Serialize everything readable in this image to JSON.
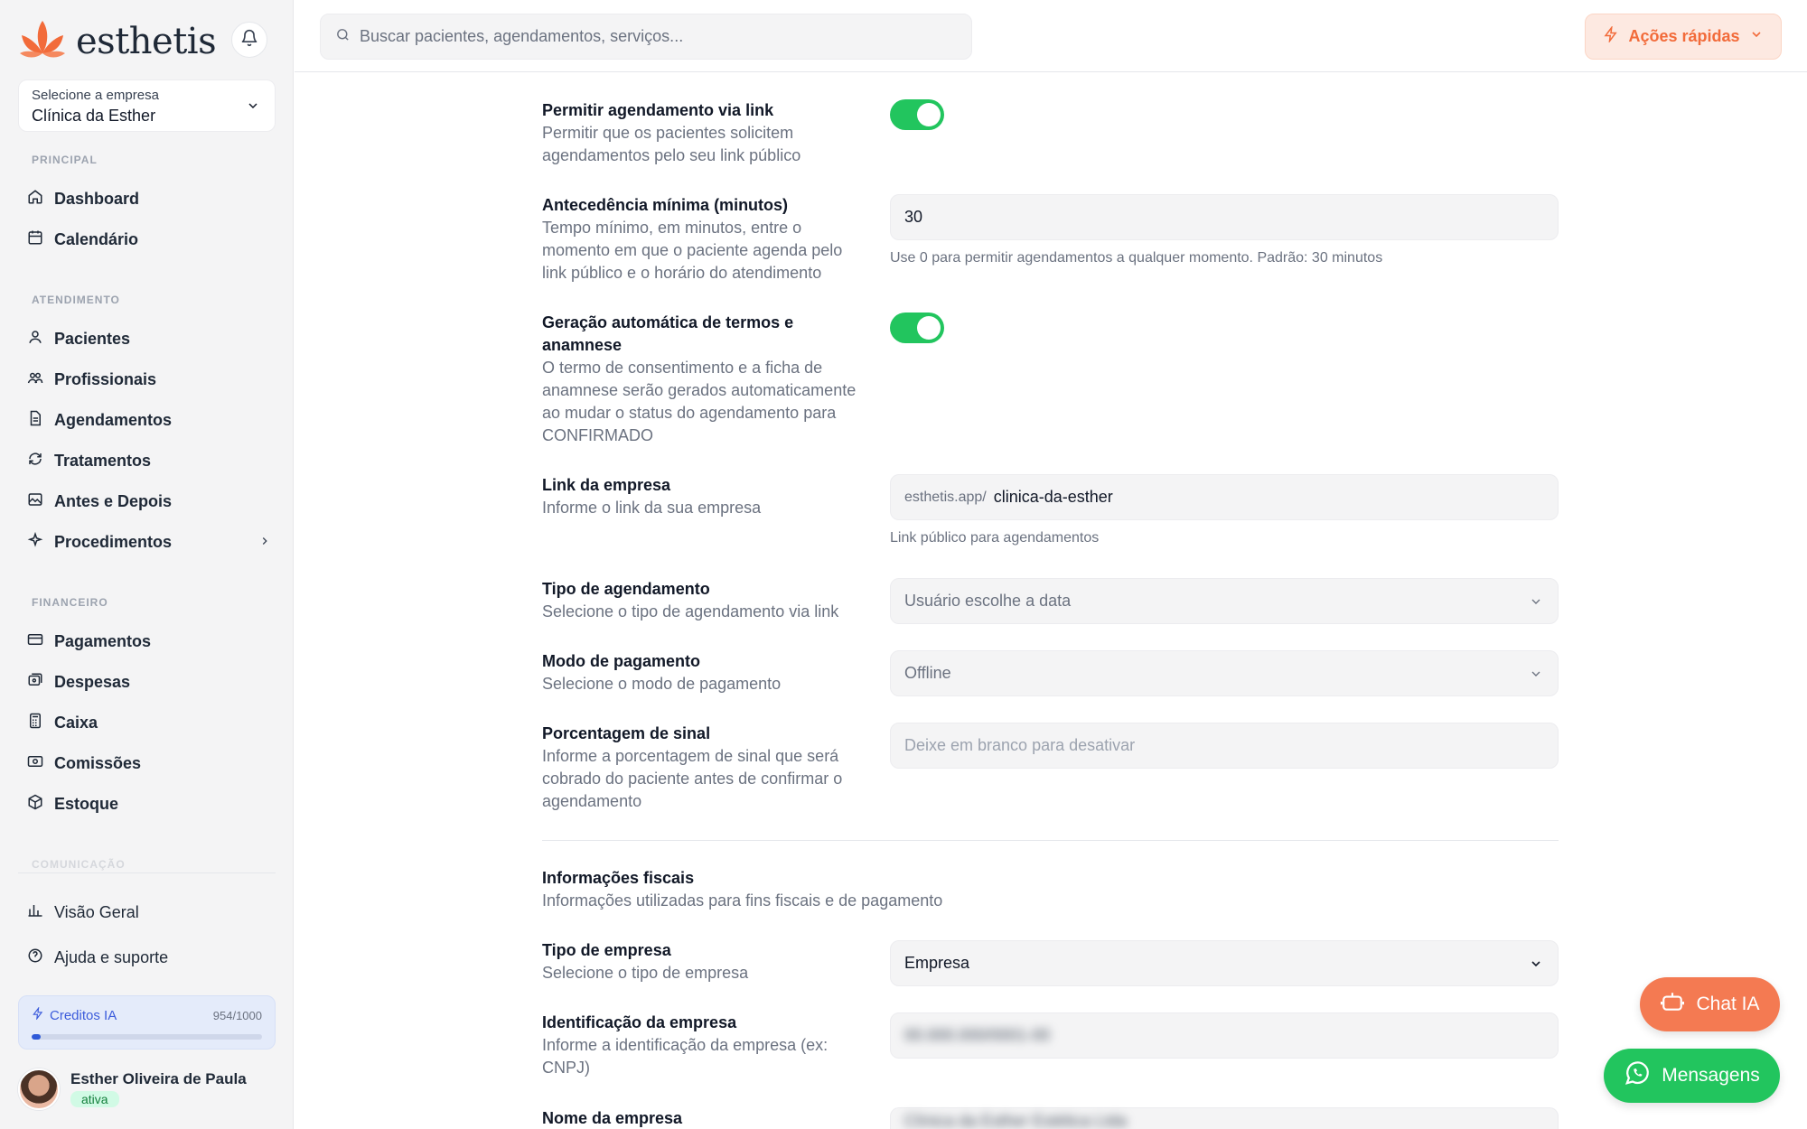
{
  "brand": {
    "name": "esthetis",
    "accent": "#f26b3a"
  },
  "company_select": {
    "label": "Selecione a empresa",
    "value": "Clínica da Esther"
  },
  "sidebar": {
    "sections": {
      "principal": "PRINCIPAL",
      "atendimento": "ATENDIMENTO",
      "financeiro": "FINANCEIRO",
      "comunicacao": "COMUNICAÇÃO"
    },
    "items": {
      "dashboard": "Dashboard",
      "calendario": "Calendário",
      "pacientes": "Pacientes",
      "profissionais": "Profissionais",
      "agendamentos": "Agendamentos",
      "tratamentos": "Tratamentos",
      "antes_depois": "Antes e Depois",
      "procedimentos": "Procedimentos",
      "pagamentos": "Pagamentos",
      "despesas": "Despesas",
      "caixa": "Caixa",
      "comissoes": "Comissões",
      "estoque": "Estoque"
    },
    "footer": {
      "visao_geral": "Visão Geral",
      "ajuda": "Ajuda e suporte"
    },
    "credits": {
      "title": "Creditos IA",
      "count": "954/1000",
      "used": 954,
      "total": 1000
    },
    "user": {
      "name": "Esther Oliveira de Paula",
      "status": "ativa"
    }
  },
  "topbar": {
    "search_placeholder": "Buscar pacientes, agendamentos, serviços...",
    "quick_actions": "Ações rápidas"
  },
  "form": {
    "allow_link": {
      "title": "Permitir agendamento via link",
      "desc": "Permitir que os pacientes solicitem agendamentos pelo seu link público",
      "enabled": true
    },
    "min_advance": {
      "title": "Antecedência mínima (minutos)",
      "desc": "Tempo mínimo, em minutos, entre o momento em que o paciente agenda pelo link público e o horário do atendimento",
      "value": "30",
      "help": "Use 0 para permitir agendamentos a qualquer momento. Padrão: 30 minutos"
    },
    "auto_terms": {
      "title": "Geração automática de termos e anamnese",
      "desc": "O termo de consentimento e a ficha de anamnese serão gerados automaticamente ao mudar o status do agendamento para CONFIRMADO",
      "enabled": true
    },
    "company_link": {
      "title": "Link da empresa",
      "desc": "Informe o link da sua empresa",
      "prefix": "esthetis.app/",
      "value": "clinica-da-esther",
      "help": "Link público para agendamentos"
    },
    "schedule_type": {
      "title": "Tipo de agendamento",
      "desc": "Selecione o tipo de agendamento via link",
      "value": "Usuário escolhe a data"
    },
    "payment_mode": {
      "title": "Modo de pagamento",
      "desc": "Selecione o modo de pagamento",
      "value": "Offline"
    },
    "deposit": {
      "title": "Porcentagem de sinal",
      "desc": "Informe a porcentagem de sinal que será cobrado do paciente antes de confirmar o agendamento",
      "placeholder": "Deixe em branco para desativar"
    },
    "fiscal": {
      "title": "Informações fiscais",
      "desc": "Informações utilizadas para fins fiscais e de pagamento"
    },
    "company_type": {
      "title": "Tipo de empresa",
      "desc": "Selecione o tipo de empresa",
      "value": "Empresa"
    },
    "company_id": {
      "title": "Identificação da empresa",
      "desc": "Informe a identificação da empresa (ex: CNPJ)",
      "value": "00.000.000/0001-00"
    },
    "company_name": {
      "title": "Nome da empresa",
      "value": "Clínica da Esther Estética Ltda"
    }
  },
  "floating": {
    "chat": "Chat IA",
    "messages": "Mensagens"
  }
}
